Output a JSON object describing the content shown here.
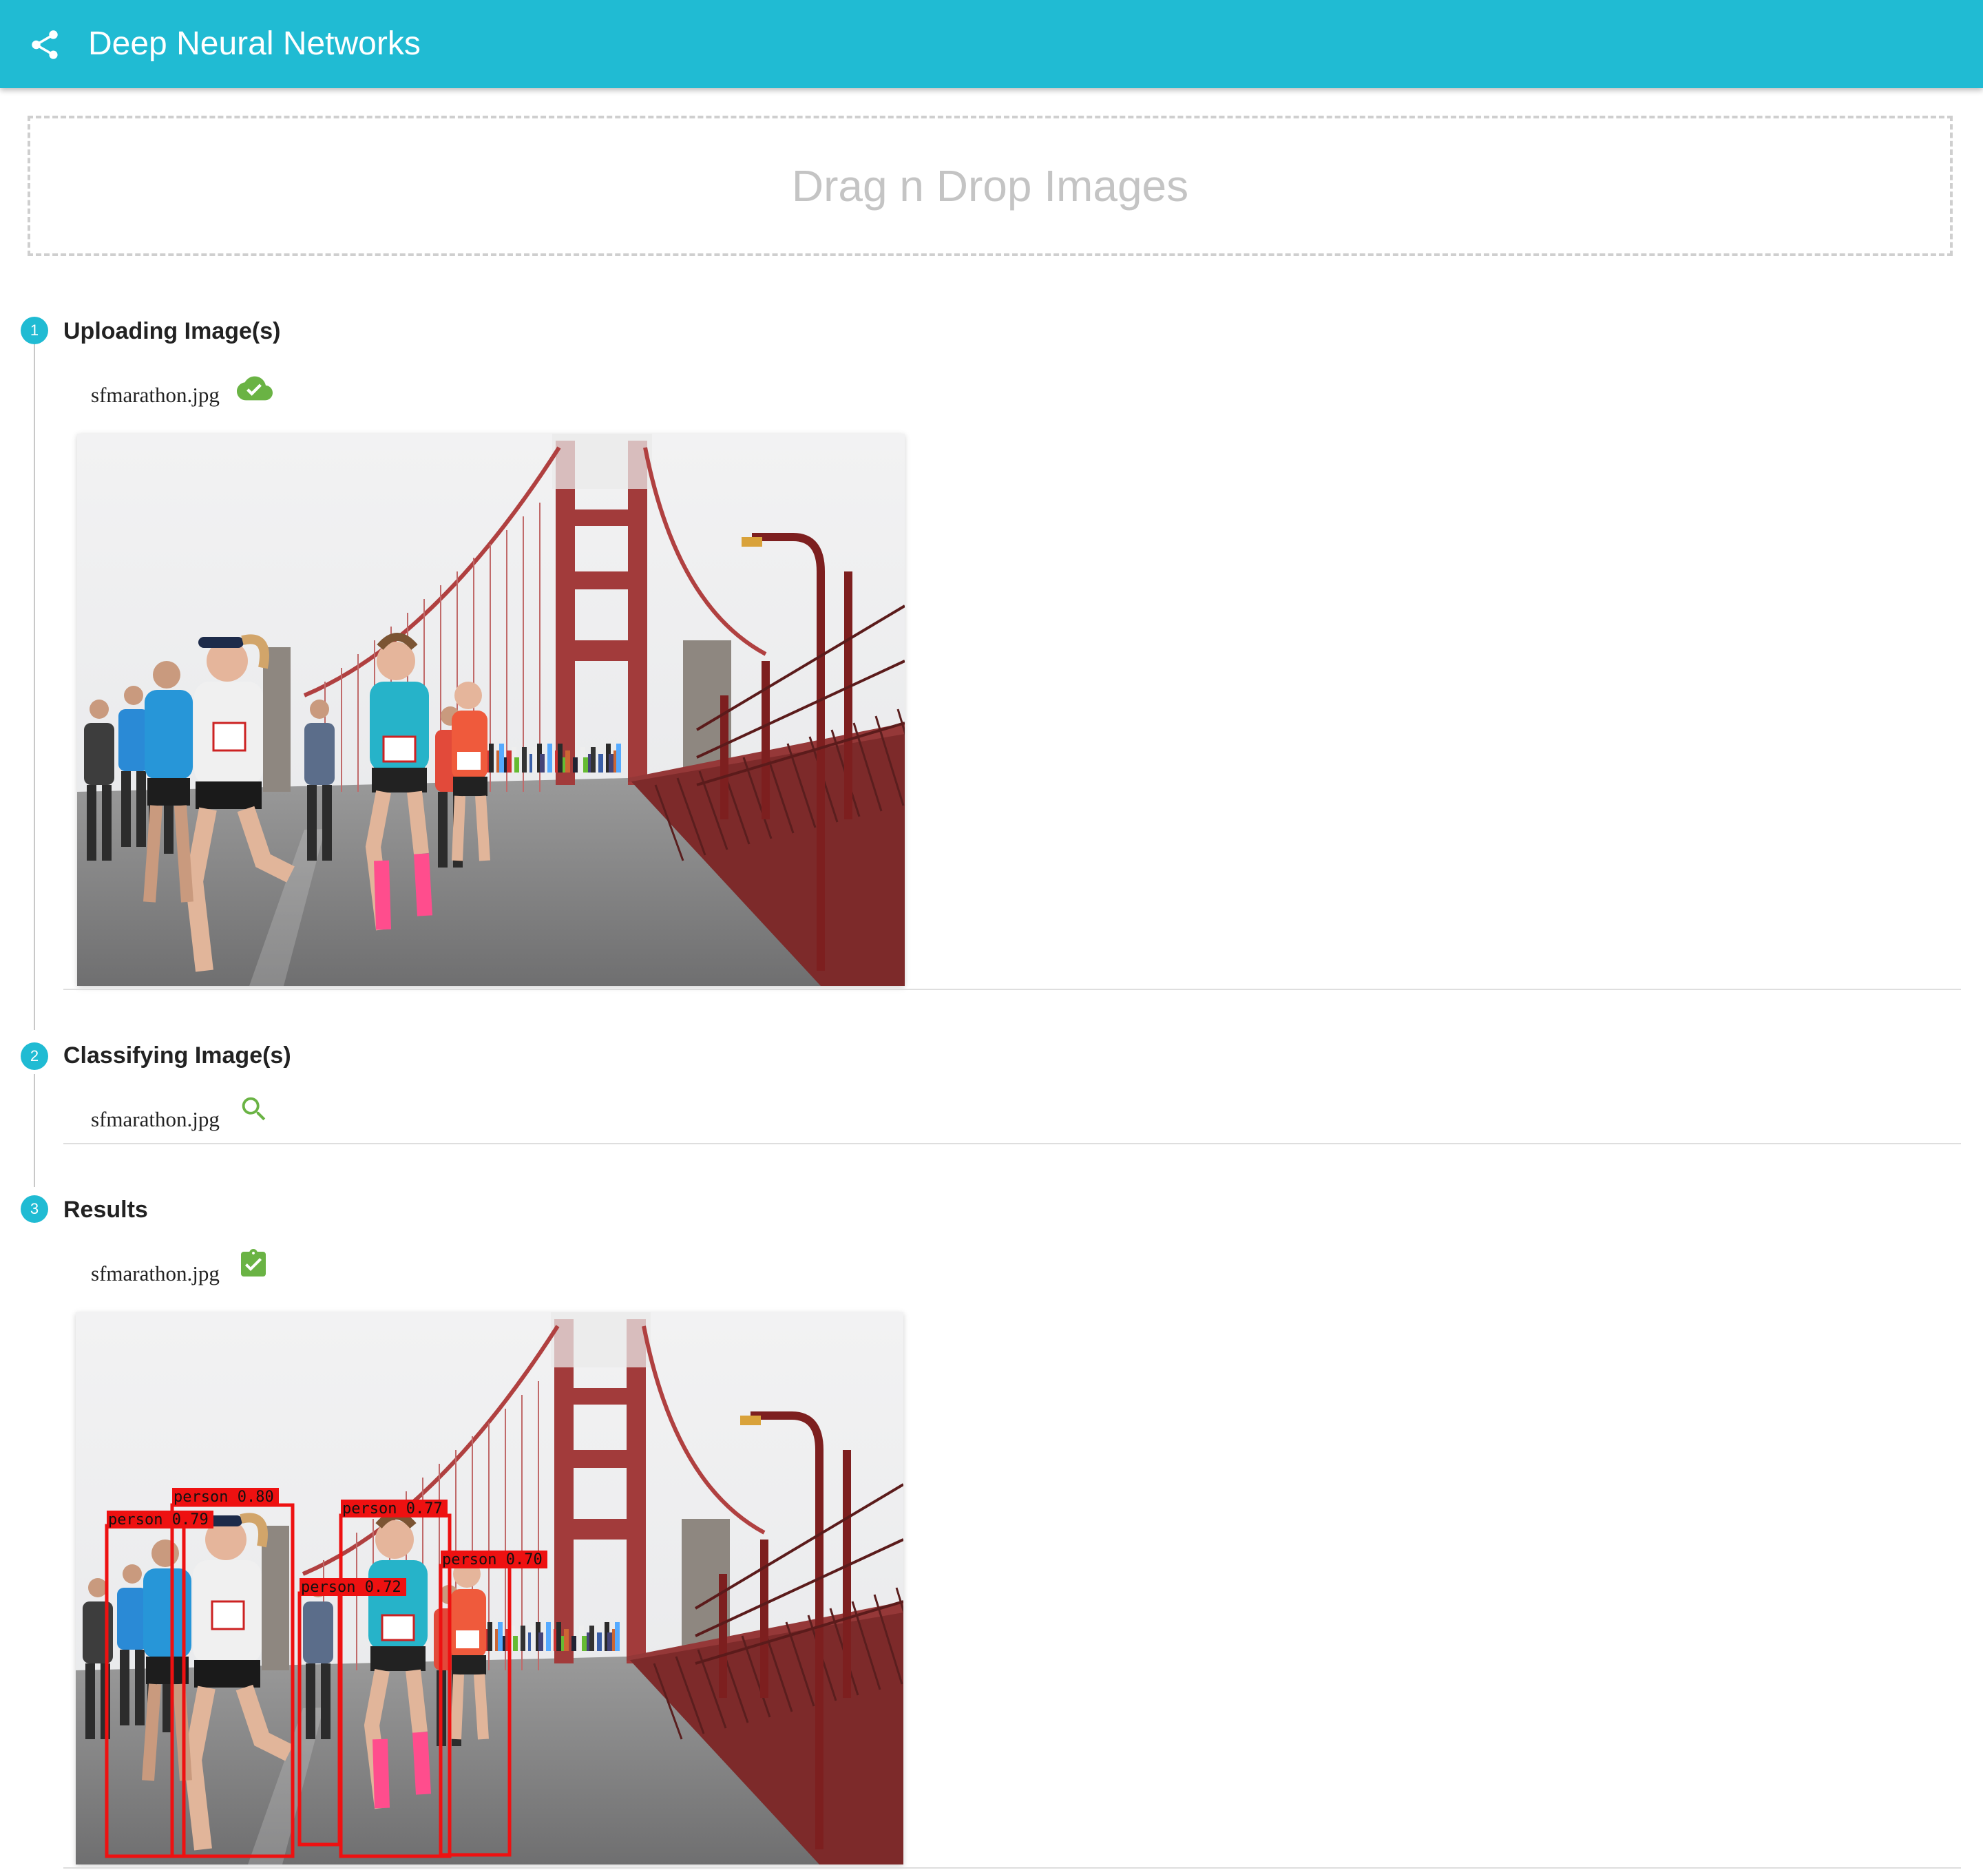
{
  "app": {
    "title": "Deep Neural Networks",
    "accent_color": "#20bbd3",
    "share_icon": "share-icon"
  },
  "dropzone": {
    "label": "Drag n Drop Images"
  },
  "steps": [
    {
      "number": "1",
      "label": "Uploading Image(s)",
      "file": "sfmarathon.jpg",
      "status_icon": "cloud-done-icon"
    },
    {
      "number": "2",
      "label": "Classifying Image(s)",
      "file": "sfmarathon.jpg",
      "status_icon": "search-icon"
    },
    {
      "number": "3",
      "label": "Results",
      "file": "sfmarathon.jpg",
      "status_icon": "assignment-turned-in-icon"
    }
  ],
  "status_color": "#6ab344",
  "detections": [
    {
      "label": "person 0.80"
    },
    {
      "label": "person 0.79"
    },
    {
      "label": "person 0.77"
    },
    {
      "label": "person 0.72"
    },
    {
      "label": "person 0.70"
    }
  ]
}
